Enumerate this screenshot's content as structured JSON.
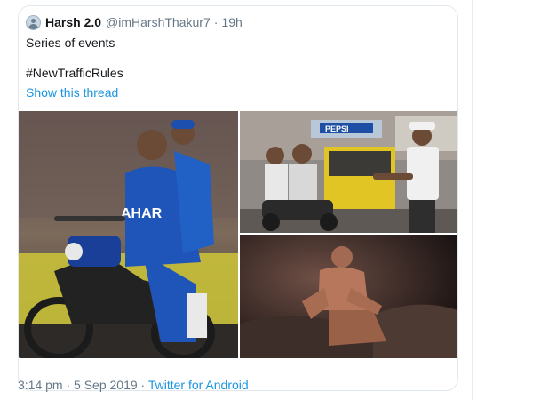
{
  "tweet": {
    "display_name": "Harsh 2.0",
    "handle": "@imHarshThakur7",
    "separator": "·",
    "time": "19h",
    "text_line_1": "Series of events",
    "text_line_2": "#NewTrafficRules",
    "thread_link": "Show this thread",
    "images": [
      {
        "icon": "photo-motorcycle-cricket"
      },
      {
        "icon": "photo-traffic-police-stop"
      },
      {
        "icon": "photo-man-sitting-dark"
      }
    ],
    "footer": {
      "time_date": "3:14 pm · 5 Sep 2019",
      "separator": "·",
      "source": "Twitter for Android"
    }
  },
  "colors": {
    "link": "#1b95e0",
    "secondary": "#657786",
    "border": "#e1e8ed"
  }
}
